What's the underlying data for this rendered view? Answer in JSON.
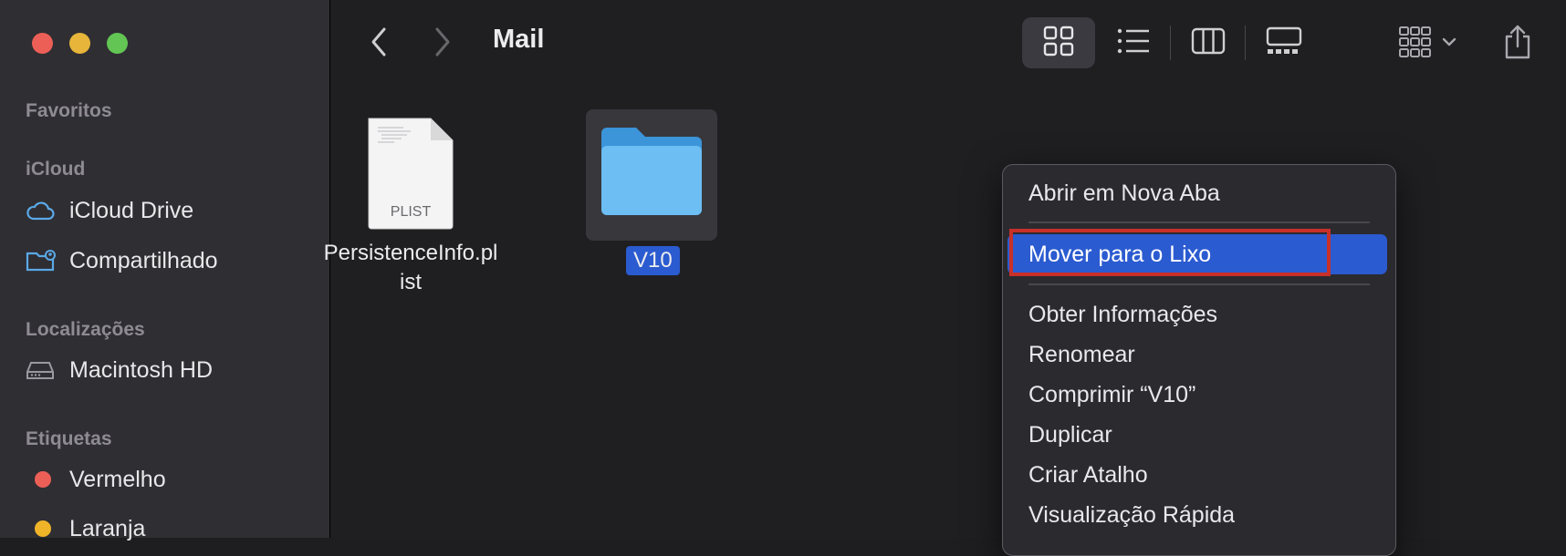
{
  "window": {
    "title": "Mail",
    "traffic_lights": {
      "close": "#ec5f57",
      "minimize": "#e6b53a",
      "zoom": "#62c554"
    }
  },
  "sidebar": {
    "favorites_title": "Favoritos",
    "icloud_title": "iCloud",
    "icloud_items": [
      {
        "label": "iCloud Drive",
        "icon": "cloud-icon"
      },
      {
        "label": "Compartilhado",
        "icon": "shared-folder-icon"
      }
    ],
    "locations_title": "Localizações",
    "location_items": [
      {
        "label": "Macintosh HD",
        "icon": "hard-drive-icon"
      }
    ],
    "tags_title": "Etiquetas",
    "tag_items": [
      {
        "label": "Vermelho",
        "color": "#ec5f57"
      },
      {
        "label": "Laranja",
        "color": "#f0b428"
      }
    ]
  },
  "toolbar": {
    "back_icon": "chevron-left-icon",
    "forward_icon": "chevron-right-icon",
    "view_icons": [
      "grid-view-icon",
      "list-view-icon",
      "column-view-icon",
      "gallery-view-icon"
    ],
    "group_icon": "group-by-icon",
    "share_icon": "share-icon"
  },
  "files": [
    {
      "name_line1": "PersistenceInfo.pl",
      "name_line2": "ist",
      "badge": "PLIST",
      "type": "document"
    },
    {
      "name": "V10",
      "type": "folder",
      "selected": true
    }
  ],
  "context_menu": {
    "items": [
      "Abrir em Nova Aba",
      "Mover para o Lixo",
      "Obter Informações",
      "Renomear",
      "Comprimir “V10”",
      "Duplicar",
      "Criar Atalho",
      "Visualização Rápida"
    ],
    "highlighted": "Mover para o Lixo",
    "highlight_color": "#2b5bd0",
    "annotation_color": "#c8302a"
  }
}
